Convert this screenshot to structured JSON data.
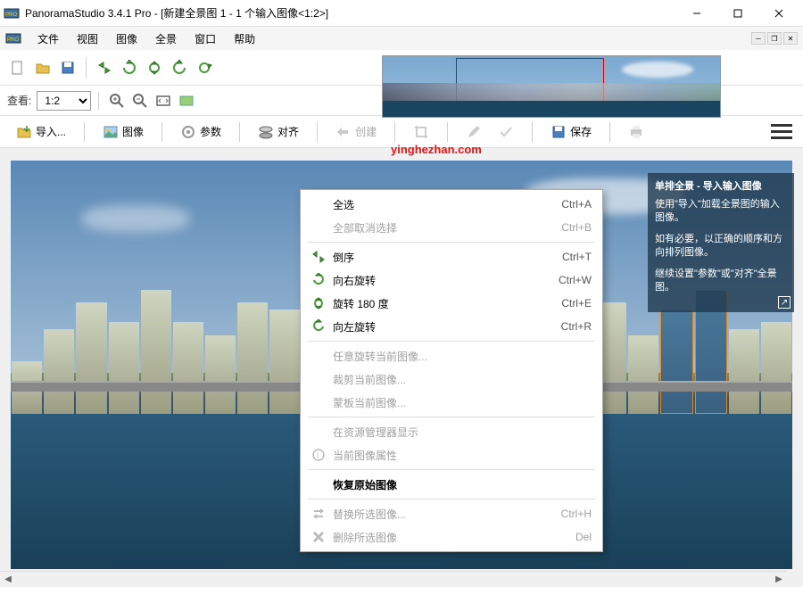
{
  "title": "PanoramaStudio 3.4.1 Pro - [新建全景图 1 - 1 个输入图像<1:2>]",
  "menubar": [
    "文件",
    "视图",
    "图像",
    "全景",
    "窗口",
    "帮助"
  ],
  "toolbar2": {
    "look_label": "查看:",
    "zoom_value": "1:2"
  },
  "toolbar3": {
    "import": "导入...",
    "image": "图像",
    "params": "参数",
    "align": "对齐",
    "create": "创建",
    "save": "保存"
  },
  "watermark": "yinghezhan.com",
  "info_panel": {
    "title": "单排全景 - 导入输入图像",
    "p1": "使用\"导入\"加载全景图的输入图像。",
    "p2": "如有必要，以正确的顺序和方向排列图像。",
    "p3": "继续设置\"参数\"或\"对齐\"全景图。"
  },
  "context_menu": [
    {
      "type": "item",
      "label": "全选",
      "shortcut": "Ctrl+A",
      "enabled": true
    },
    {
      "type": "item",
      "label": "全部取消选择",
      "shortcut": "Ctrl+B",
      "enabled": false
    },
    {
      "type": "sep"
    },
    {
      "type": "item",
      "icon": "reverse",
      "label": "倒序",
      "shortcut": "Ctrl+T",
      "enabled": true
    },
    {
      "type": "item",
      "icon": "rot-right",
      "label": "向右旋转",
      "shortcut": "Ctrl+W",
      "enabled": true
    },
    {
      "type": "item",
      "icon": "rot-180",
      "label": "旋转 180 度",
      "shortcut": "Ctrl+E",
      "enabled": true
    },
    {
      "type": "item",
      "icon": "rot-left",
      "label": "向左旋转",
      "shortcut": "Ctrl+R",
      "enabled": true
    },
    {
      "type": "sep"
    },
    {
      "type": "item",
      "label": "任意旋转当前图像...",
      "enabled": false
    },
    {
      "type": "item",
      "label": "裁剪当前图像...",
      "enabled": false
    },
    {
      "type": "item",
      "label": "蒙板当前图像...",
      "enabled": false
    },
    {
      "type": "sep"
    },
    {
      "type": "item",
      "label": "在资源管理器显示",
      "enabled": false
    },
    {
      "type": "item",
      "icon": "info",
      "label": "当前图像属性",
      "enabled": false
    },
    {
      "type": "sep"
    },
    {
      "type": "item",
      "label": "恢复原始图像",
      "enabled": true,
      "bold": true
    },
    {
      "type": "sep"
    },
    {
      "type": "item",
      "icon": "replace",
      "label": "替换所选图像...",
      "shortcut": "Ctrl+H",
      "enabled": false
    },
    {
      "type": "item",
      "icon": "delete",
      "label": "删除所选图像",
      "shortcut": "Del",
      "enabled": false
    }
  ]
}
